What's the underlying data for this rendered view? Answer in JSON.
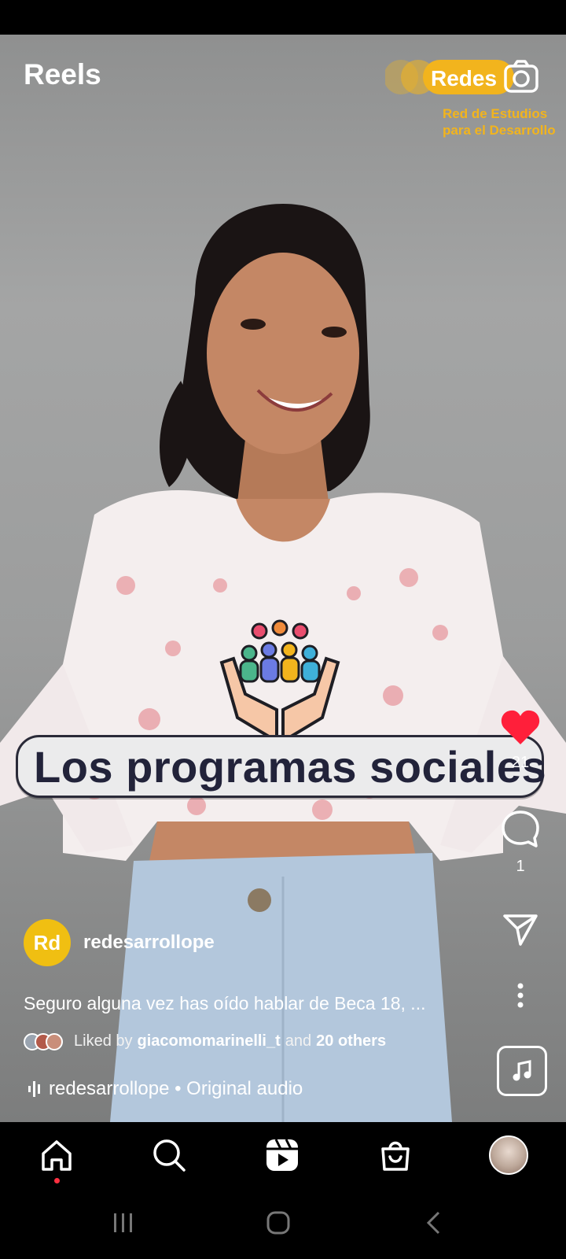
{
  "header": {
    "title": "Reels"
  },
  "brand": {
    "logo_text": "Redes",
    "subtitle_line1": "Red de Estudios",
    "subtitle_line2": "para el Desarrollo",
    "accent": "#f2b41d"
  },
  "video_overlay": {
    "caption": "Los programas sociales"
  },
  "actions": {
    "like_count": "21",
    "comment_count": "1"
  },
  "author": {
    "avatar_initials": "Rd",
    "username": "redesarrollope",
    "avatar_color": "#f0bf12"
  },
  "post": {
    "caption": "Seguro alguna vez has oído hablar de Beca 18, ...",
    "liked_prefix": "Liked by",
    "liked_user": "giacomomarinelli_t",
    "liked_and": "and",
    "liked_others": "20 others",
    "audio": "redesarrollope • Original audio"
  },
  "nav": {
    "items": [
      {
        "icon": "home-icon",
        "active": true
      },
      {
        "icon": "search-icon"
      },
      {
        "icon": "reels-icon"
      },
      {
        "icon": "shop-icon"
      },
      {
        "icon": "profile-avatar"
      }
    ]
  }
}
